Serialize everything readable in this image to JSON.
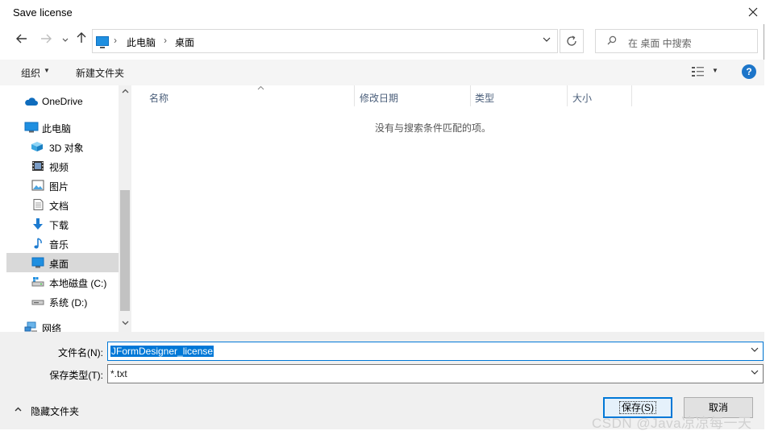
{
  "window": {
    "title": "Save license"
  },
  "address": {
    "crumbs": [
      "此电脑",
      "桌面"
    ]
  },
  "search": {
    "placeholder": "在 桌面 中搜索"
  },
  "toolbar": {
    "organize": "组织",
    "new_folder": "新建文件夹",
    "help": "?"
  },
  "nav_pane": {
    "items": [
      {
        "label": "OneDrive",
        "icon": "cloud-icon"
      },
      {
        "label": "此电脑",
        "icon": "computer-icon"
      },
      {
        "label": "3D 对象",
        "icon": "cube-icon"
      },
      {
        "label": "视频",
        "icon": "film-icon"
      },
      {
        "label": "图片",
        "icon": "picture-icon"
      },
      {
        "label": "文档",
        "icon": "document-icon"
      },
      {
        "label": "下载",
        "icon": "download-arrow-icon"
      },
      {
        "label": "音乐",
        "icon": "music-note-icon"
      },
      {
        "label": "桌面",
        "icon": "desktop-icon",
        "selected": true
      },
      {
        "label": "本地磁盘 (C:)",
        "icon": "drive-c-icon"
      },
      {
        "label": "系统 (D:)",
        "icon": "drive-d-icon"
      },
      {
        "label": "网络",
        "icon": "network-icon"
      }
    ]
  },
  "file_list": {
    "columns": [
      "名称",
      "修改日期",
      "类型",
      "大小"
    ],
    "empty_message": "没有与搜索条件匹配的项。"
  },
  "form": {
    "filename_label": "文件名(N):",
    "filename_value": "JFormDesigner_license",
    "filetype_label": "保存类型(T):",
    "filetype_value": "*.txt"
  },
  "footer": {
    "hide_folders": "隐藏文件夹",
    "save_label": "保存(S)",
    "cancel_label": "取消"
  },
  "watermark": "CSDN @Java凉凉每一天",
  "colors": {
    "accent": "#0078d7",
    "selected_bg": "#d9d9d9",
    "help_blue": "#1d75c9"
  }
}
